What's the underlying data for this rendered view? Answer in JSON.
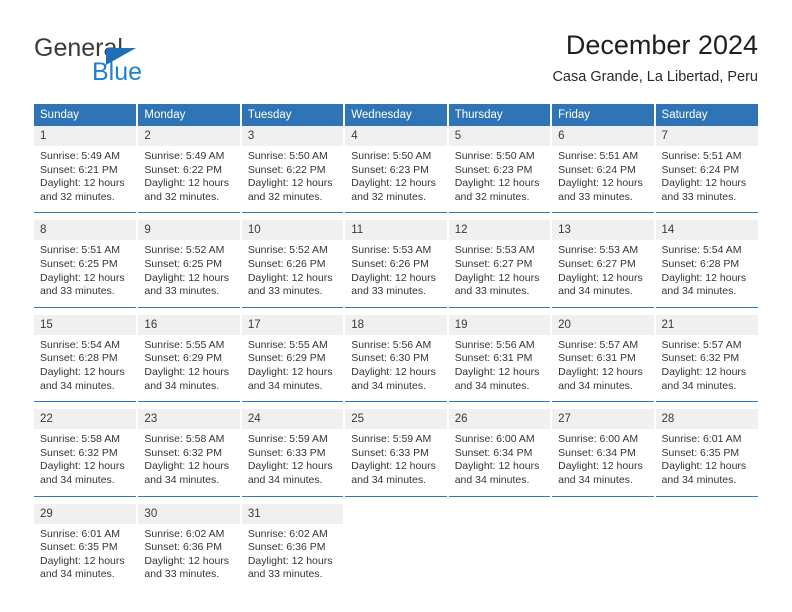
{
  "brand": {
    "name_top": "General",
    "name_bottom": "Blue",
    "triangle_color": "#1f6fb5",
    "blue_text_color": "#1f7fd0"
  },
  "header": {
    "title": "December 2024",
    "subtitle": "Casa Grande, La Libertad, Peru"
  },
  "theme": {
    "header_blue": "#2f74b5",
    "daynum_bg": "#f0f0f0",
    "text": "#353535"
  },
  "calendar": {
    "weekday_headers": [
      "Sunday",
      "Monday",
      "Tuesday",
      "Wednesday",
      "Thursday",
      "Friday",
      "Saturday"
    ],
    "labels": {
      "sunrise_prefix": "Sunrise: ",
      "sunset_prefix": "Sunset: ",
      "daylight_prefix": "Daylight: "
    },
    "weeks": [
      [
        {
          "day": "1",
          "sunrise": "Sunrise: 5:49 AM",
          "sunset": "Sunset: 6:21 PM",
          "daylight_line1": "Daylight: 12 hours",
          "daylight_line2": "and 32 minutes."
        },
        {
          "day": "2",
          "sunrise": "Sunrise: 5:49 AM",
          "sunset": "Sunset: 6:22 PM",
          "daylight_line1": "Daylight: 12 hours",
          "daylight_line2": "and 32 minutes."
        },
        {
          "day": "3",
          "sunrise": "Sunrise: 5:50 AM",
          "sunset": "Sunset: 6:22 PM",
          "daylight_line1": "Daylight: 12 hours",
          "daylight_line2": "and 32 minutes."
        },
        {
          "day": "4",
          "sunrise": "Sunrise: 5:50 AM",
          "sunset": "Sunset: 6:23 PM",
          "daylight_line1": "Daylight: 12 hours",
          "daylight_line2": "and 32 minutes."
        },
        {
          "day": "5",
          "sunrise": "Sunrise: 5:50 AM",
          "sunset": "Sunset: 6:23 PM",
          "daylight_line1": "Daylight: 12 hours",
          "daylight_line2": "and 32 minutes."
        },
        {
          "day": "6",
          "sunrise": "Sunrise: 5:51 AM",
          "sunset": "Sunset: 6:24 PM",
          "daylight_line1": "Daylight: 12 hours",
          "daylight_line2": "and 33 minutes."
        },
        {
          "day": "7",
          "sunrise": "Sunrise: 5:51 AM",
          "sunset": "Sunset: 6:24 PM",
          "daylight_line1": "Daylight: 12 hours",
          "daylight_line2": "and 33 minutes."
        }
      ],
      [
        {
          "day": "8",
          "sunrise": "Sunrise: 5:51 AM",
          "sunset": "Sunset: 6:25 PM",
          "daylight_line1": "Daylight: 12 hours",
          "daylight_line2": "and 33 minutes."
        },
        {
          "day": "9",
          "sunrise": "Sunrise: 5:52 AM",
          "sunset": "Sunset: 6:25 PM",
          "daylight_line1": "Daylight: 12 hours",
          "daylight_line2": "and 33 minutes."
        },
        {
          "day": "10",
          "sunrise": "Sunrise: 5:52 AM",
          "sunset": "Sunset: 6:26 PM",
          "daylight_line1": "Daylight: 12 hours",
          "daylight_line2": "and 33 minutes."
        },
        {
          "day": "11",
          "sunrise": "Sunrise: 5:53 AM",
          "sunset": "Sunset: 6:26 PM",
          "daylight_line1": "Daylight: 12 hours",
          "daylight_line2": "and 33 minutes."
        },
        {
          "day": "12",
          "sunrise": "Sunrise: 5:53 AM",
          "sunset": "Sunset: 6:27 PM",
          "daylight_line1": "Daylight: 12 hours",
          "daylight_line2": "and 33 minutes."
        },
        {
          "day": "13",
          "sunrise": "Sunrise: 5:53 AM",
          "sunset": "Sunset: 6:27 PM",
          "daylight_line1": "Daylight: 12 hours",
          "daylight_line2": "and 34 minutes."
        },
        {
          "day": "14",
          "sunrise": "Sunrise: 5:54 AM",
          "sunset": "Sunset: 6:28 PM",
          "daylight_line1": "Daylight: 12 hours",
          "daylight_line2": "and 34 minutes."
        }
      ],
      [
        {
          "day": "15",
          "sunrise": "Sunrise: 5:54 AM",
          "sunset": "Sunset: 6:28 PM",
          "daylight_line1": "Daylight: 12 hours",
          "daylight_line2": "and 34 minutes."
        },
        {
          "day": "16",
          "sunrise": "Sunrise: 5:55 AM",
          "sunset": "Sunset: 6:29 PM",
          "daylight_line1": "Daylight: 12 hours",
          "daylight_line2": "and 34 minutes."
        },
        {
          "day": "17",
          "sunrise": "Sunrise: 5:55 AM",
          "sunset": "Sunset: 6:29 PM",
          "daylight_line1": "Daylight: 12 hours",
          "daylight_line2": "and 34 minutes."
        },
        {
          "day": "18",
          "sunrise": "Sunrise: 5:56 AM",
          "sunset": "Sunset: 6:30 PM",
          "daylight_line1": "Daylight: 12 hours",
          "daylight_line2": "and 34 minutes."
        },
        {
          "day": "19",
          "sunrise": "Sunrise: 5:56 AM",
          "sunset": "Sunset: 6:31 PM",
          "daylight_line1": "Daylight: 12 hours",
          "daylight_line2": "and 34 minutes."
        },
        {
          "day": "20",
          "sunrise": "Sunrise: 5:57 AM",
          "sunset": "Sunset: 6:31 PM",
          "daylight_line1": "Daylight: 12 hours",
          "daylight_line2": "and 34 minutes."
        },
        {
          "day": "21",
          "sunrise": "Sunrise: 5:57 AM",
          "sunset": "Sunset: 6:32 PM",
          "daylight_line1": "Daylight: 12 hours",
          "daylight_line2": "and 34 minutes."
        }
      ],
      [
        {
          "day": "22",
          "sunrise": "Sunrise: 5:58 AM",
          "sunset": "Sunset: 6:32 PM",
          "daylight_line1": "Daylight: 12 hours",
          "daylight_line2": "and 34 minutes."
        },
        {
          "day": "23",
          "sunrise": "Sunrise: 5:58 AM",
          "sunset": "Sunset: 6:32 PM",
          "daylight_line1": "Daylight: 12 hours",
          "daylight_line2": "and 34 minutes."
        },
        {
          "day": "24",
          "sunrise": "Sunrise: 5:59 AM",
          "sunset": "Sunset: 6:33 PM",
          "daylight_line1": "Daylight: 12 hours",
          "daylight_line2": "and 34 minutes."
        },
        {
          "day": "25",
          "sunrise": "Sunrise: 5:59 AM",
          "sunset": "Sunset: 6:33 PM",
          "daylight_line1": "Daylight: 12 hours",
          "daylight_line2": "and 34 minutes."
        },
        {
          "day": "26",
          "sunrise": "Sunrise: 6:00 AM",
          "sunset": "Sunset: 6:34 PM",
          "daylight_line1": "Daylight: 12 hours",
          "daylight_line2": "and 34 minutes."
        },
        {
          "day": "27",
          "sunrise": "Sunrise: 6:00 AM",
          "sunset": "Sunset: 6:34 PM",
          "daylight_line1": "Daylight: 12 hours",
          "daylight_line2": "and 34 minutes."
        },
        {
          "day": "28",
          "sunrise": "Sunrise: 6:01 AM",
          "sunset": "Sunset: 6:35 PM",
          "daylight_line1": "Daylight: 12 hours",
          "daylight_line2": "and 34 minutes."
        }
      ],
      [
        {
          "day": "29",
          "sunrise": "Sunrise: 6:01 AM",
          "sunset": "Sunset: 6:35 PM",
          "daylight_line1": "Daylight: 12 hours",
          "daylight_line2": "and 34 minutes."
        },
        {
          "day": "30",
          "sunrise": "Sunrise: 6:02 AM",
          "sunset": "Sunset: 6:36 PM",
          "daylight_line1": "Daylight: 12 hours",
          "daylight_line2": "and 33 minutes."
        },
        {
          "day": "31",
          "sunrise": "Sunrise: 6:02 AM",
          "sunset": "Sunset: 6:36 PM",
          "daylight_line1": "Daylight: 12 hours",
          "daylight_line2": "and 33 minutes."
        },
        {
          "day": "",
          "sunrise": "",
          "sunset": "",
          "daylight_line1": "",
          "daylight_line2": ""
        },
        {
          "day": "",
          "sunrise": "",
          "sunset": "",
          "daylight_line1": "",
          "daylight_line2": ""
        },
        {
          "day": "",
          "sunrise": "",
          "sunset": "",
          "daylight_line1": "",
          "daylight_line2": ""
        },
        {
          "day": "",
          "sunrise": "",
          "sunset": "",
          "daylight_line1": "",
          "daylight_line2": ""
        }
      ]
    ]
  }
}
